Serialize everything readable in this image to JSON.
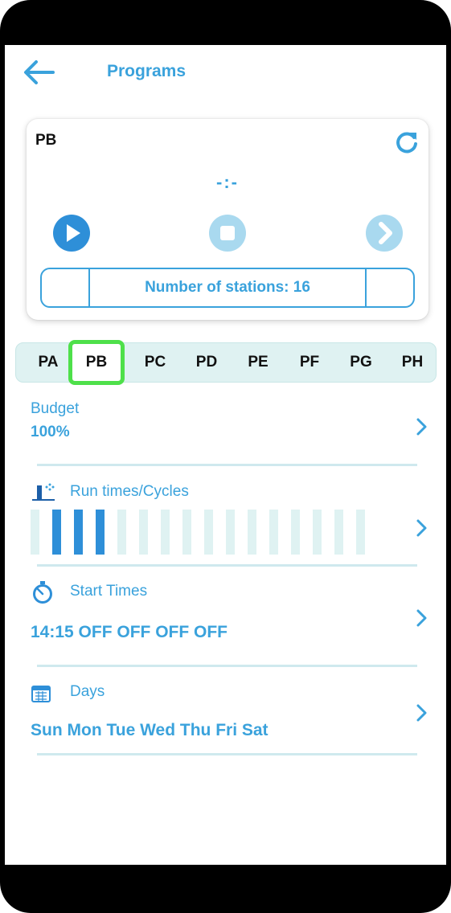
{
  "header": {
    "title": "Programs"
  },
  "program_card": {
    "name": "PB",
    "time_display": "-:-",
    "stations_label": "Number of stations: 16"
  },
  "tabs": [
    {
      "label": "PA",
      "active": false
    },
    {
      "label": "PB",
      "active": true
    },
    {
      "label": "PC",
      "active": false
    },
    {
      "label": "PD",
      "active": false
    },
    {
      "label": "PE",
      "active": false
    },
    {
      "label": "PF",
      "active": false
    },
    {
      "label": "PG",
      "active": false
    },
    {
      "label": "PH",
      "active": false
    }
  ],
  "budget": {
    "label": "Budget",
    "value": "100%"
  },
  "run_times": {
    "label": "Run times/Cycles",
    "bars_on": [
      false,
      true,
      true,
      true,
      false,
      false,
      false,
      false,
      false,
      false,
      false,
      false,
      false,
      false,
      false,
      false
    ]
  },
  "start_times": {
    "label": "Start Times",
    "value": "14:15 OFF OFF OFF OFF"
  },
  "days": {
    "label": "Days",
    "value": "Sun Mon Tue Wed Thu Fri Sat"
  },
  "colors": {
    "accent": "#3aa2dc",
    "highlight": "#4ee04a",
    "tab_bg": "#dff2f2"
  }
}
